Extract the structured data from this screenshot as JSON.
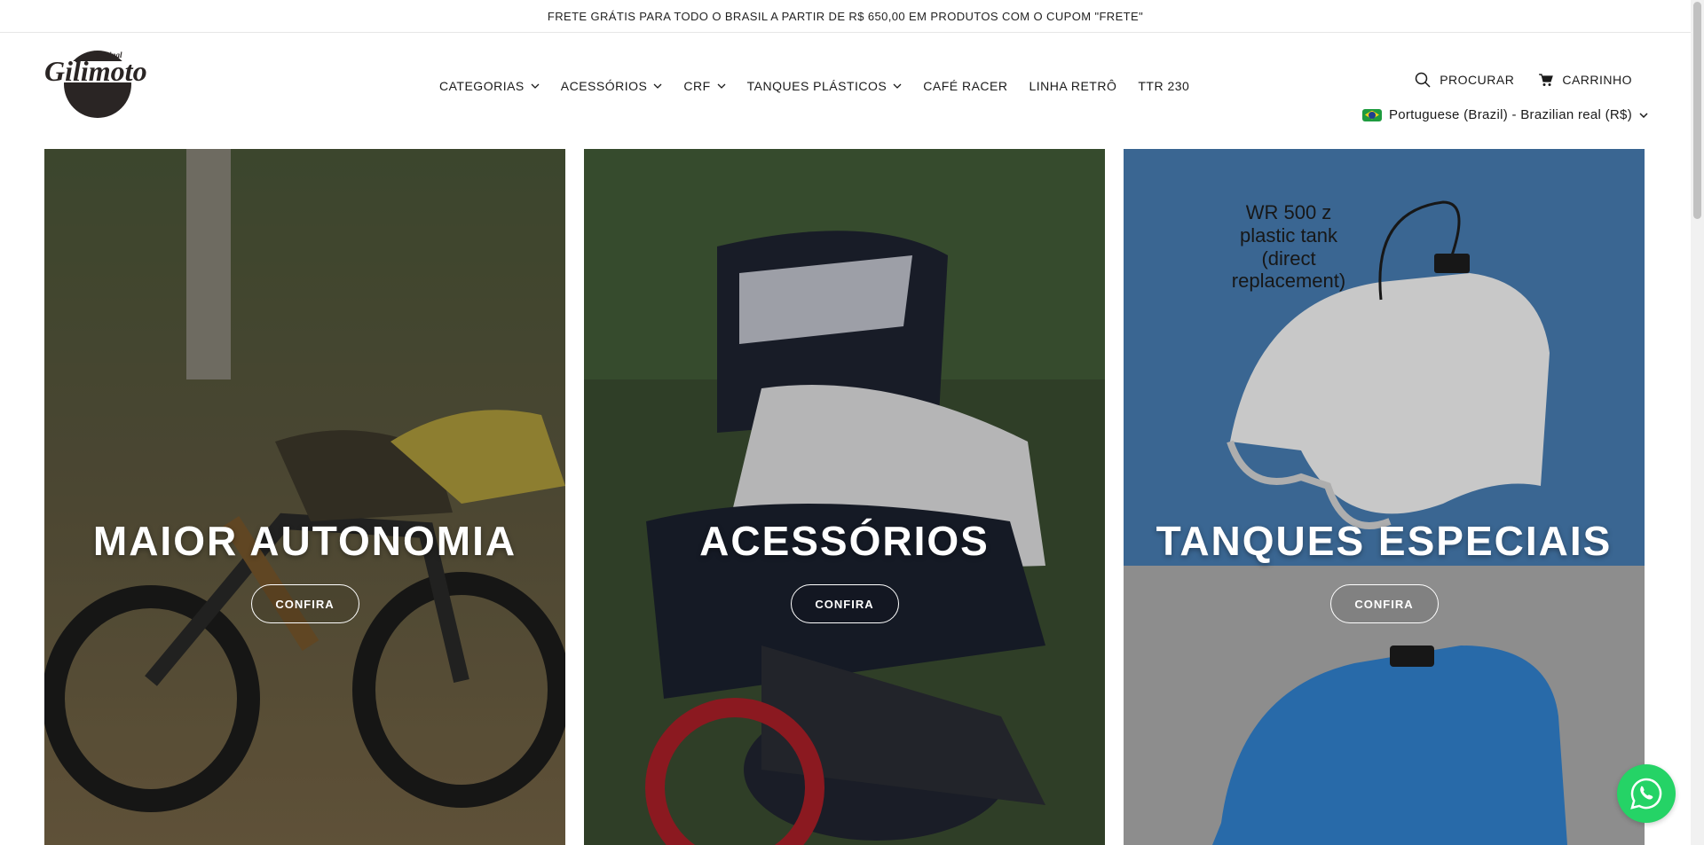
{
  "announcement": "FRETE GRÁTIS PARA TODO O BRASIL A PARTIR DE R$ 650,00 EM PRODUTOS COM O CUPOM \"FRETE\"",
  "brand": {
    "logo_text": "Gilimoto",
    "logo_tag": "original"
  },
  "nav": [
    {
      "label": "CATEGORIAS",
      "has_dropdown": true
    },
    {
      "label": "ACESSÓRIOS",
      "has_dropdown": true
    },
    {
      "label": "CRF",
      "has_dropdown": true
    },
    {
      "label": "TANQUES PLÁSTICOS",
      "has_dropdown": true
    },
    {
      "label": "CAFÉ RACER",
      "has_dropdown": false
    },
    {
      "label": "LINHA RETRÔ",
      "has_dropdown": false
    },
    {
      "label": "TTR 230",
      "has_dropdown": false
    }
  ],
  "tools": {
    "search_label": "PROCURAR",
    "cart_label": "CARRINHO"
  },
  "locale": {
    "label": "Portuguese (Brazil) - Brazilian real (R$)"
  },
  "cards": [
    {
      "title": "MAIOR AUTONOMIA",
      "button": "CONFIRA"
    },
    {
      "title": "ACESSÓRIOS",
      "button": "CONFIRA"
    },
    {
      "title": "TANQUES ESPECIAIS",
      "button": "CONFIRA",
      "image_text": [
        "WR 500 z",
        "plastic tank",
        "(direct",
        "replacement)"
      ]
    }
  ],
  "colors": {
    "whatsapp": "#25d366",
    "card3_top": "#3f6f9f",
    "card3_bottom": "#9a9a9a"
  },
  "icons": {
    "search": "search-icon",
    "cart": "cart-icon",
    "chevron": "chevron-down-icon",
    "whatsapp": "whatsapp-icon"
  }
}
